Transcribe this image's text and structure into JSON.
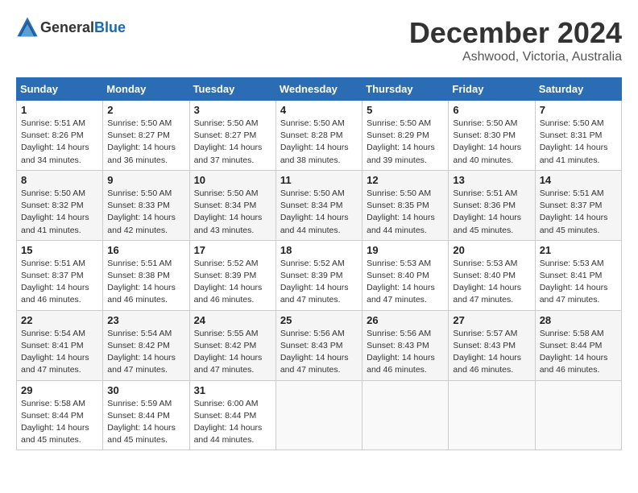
{
  "header": {
    "logo": {
      "general": "General",
      "blue": "Blue"
    },
    "month": "December 2024",
    "location": "Ashwood, Victoria, Australia"
  },
  "weekdays": [
    "Sunday",
    "Monday",
    "Tuesday",
    "Wednesday",
    "Thursday",
    "Friday",
    "Saturday"
  ],
  "weeks": [
    [
      {
        "day": "1",
        "info": "Sunrise: 5:51 AM\nSunset: 8:26 PM\nDaylight: 14 hours\nand 34 minutes."
      },
      {
        "day": "2",
        "info": "Sunrise: 5:50 AM\nSunset: 8:27 PM\nDaylight: 14 hours\nand 36 minutes."
      },
      {
        "day": "3",
        "info": "Sunrise: 5:50 AM\nSunset: 8:27 PM\nDaylight: 14 hours\nand 37 minutes."
      },
      {
        "day": "4",
        "info": "Sunrise: 5:50 AM\nSunset: 8:28 PM\nDaylight: 14 hours\nand 38 minutes."
      },
      {
        "day": "5",
        "info": "Sunrise: 5:50 AM\nSunset: 8:29 PM\nDaylight: 14 hours\nand 39 minutes."
      },
      {
        "day": "6",
        "info": "Sunrise: 5:50 AM\nSunset: 8:30 PM\nDaylight: 14 hours\nand 40 minutes."
      },
      {
        "day": "7",
        "info": "Sunrise: 5:50 AM\nSunset: 8:31 PM\nDaylight: 14 hours\nand 41 minutes."
      }
    ],
    [
      {
        "day": "8",
        "info": "Sunrise: 5:50 AM\nSunset: 8:32 PM\nDaylight: 14 hours\nand 41 minutes."
      },
      {
        "day": "9",
        "info": "Sunrise: 5:50 AM\nSunset: 8:33 PM\nDaylight: 14 hours\nand 42 minutes."
      },
      {
        "day": "10",
        "info": "Sunrise: 5:50 AM\nSunset: 8:34 PM\nDaylight: 14 hours\nand 43 minutes."
      },
      {
        "day": "11",
        "info": "Sunrise: 5:50 AM\nSunset: 8:34 PM\nDaylight: 14 hours\nand 44 minutes."
      },
      {
        "day": "12",
        "info": "Sunrise: 5:50 AM\nSunset: 8:35 PM\nDaylight: 14 hours\nand 44 minutes."
      },
      {
        "day": "13",
        "info": "Sunrise: 5:51 AM\nSunset: 8:36 PM\nDaylight: 14 hours\nand 45 minutes."
      },
      {
        "day": "14",
        "info": "Sunrise: 5:51 AM\nSunset: 8:37 PM\nDaylight: 14 hours\nand 45 minutes."
      }
    ],
    [
      {
        "day": "15",
        "info": "Sunrise: 5:51 AM\nSunset: 8:37 PM\nDaylight: 14 hours\nand 46 minutes."
      },
      {
        "day": "16",
        "info": "Sunrise: 5:51 AM\nSunset: 8:38 PM\nDaylight: 14 hours\nand 46 minutes."
      },
      {
        "day": "17",
        "info": "Sunrise: 5:52 AM\nSunset: 8:39 PM\nDaylight: 14 hours\nand 46 minutes."
      },
      {
        "day": "18",
        "info": "Sunrise: 5:52 AM\nSunset: 8:39 PM\nDaylight: 14 hours\nand 47 minutes."
      },
      {
        "day": "19",
        "info": "Sunrise: 5:53 AM\nSunset: 8:40 PM\nDaylight: 14 hours\nand 47 minutes."
      },
      {
        "day": "20",
        "info": "Sunrise: 5:53 AM\nSunset: 8:40 PM\nDaylight: 14 hours\nand 47 minutes."
      },
      {
        "day": "21",
        "info": "Sunrise: 5:53 AM\nSunset: 8:41 PM\nDaylight: 14 hours\nand 47 minutes."
      }
    ],
    [
      {
        "day": "22",
        "info": "Sunrise: 5:54 AM\nSunset: 8:41 PM\nDaylight: 14 hours\nand 47 minutes."
      },
      {
        "day": "23",
        "info": "Sunrise: 5:54 AM\nSunset: 8:42 PM\nDaylight: 14 hours\nand 47 minutes."
      },
      {
        "day": "24",
        "info": "Sunrise: 5:55 AM\nSunset: 8:42 PM\nDaylight: 14 hours\nand 47 minutes."
      },
      {
        "day": "25",
        "info": "Sunrise: 5:56 AM\nSunset: 8:43 PM\nDaylight: 14 hours\nand 47 minutes."
      },
      {
        "day": "26",
        "info": "Sunrise: 5:56 AM\nSunset: 8:43 PM\nDaylight: 14 hours\nand 46 minutes."
      },
      {
        "day": "27",
        "info": "Sunrise: 5:57 AM\nSunset: 8:43 PM\nDaylight: 14 hours\nand 46 minutes."
      },
      {
        "day": "28",
        "info": "Sunrise: 5:58 AM\nSunset: 8:44 PM\nDaylight: 14 hours\nand 46 minutes."
      }
    ],
    [
      {
        "day": "29",
        "info": "Sunrise: 5:58 AM\nSunset: 8:44 PM\nDaylight: 14 hours\nand 45 minutes."
      },
      {
        "day": "30",
        "info": "Sunrise: 5:59 AM\nSunset: 8:44 PM\nDaylight: 14 hours\nand 45 minutes."
      },
      {
        "day": "31",
        "info": "Sunrise: 6:00 AM\nSunset: 8:44 PM\nDaylight: 14 hours\nand 44 minutes."
      },
      {
        "day": "",
        "info": ""
      },
      {
        "day": "",
        "info": ""
      },
      {
        "day": "",
        "info": ""
      },
      {
        "day": "",
        "info": ""
      }
    ]
  ]
}
